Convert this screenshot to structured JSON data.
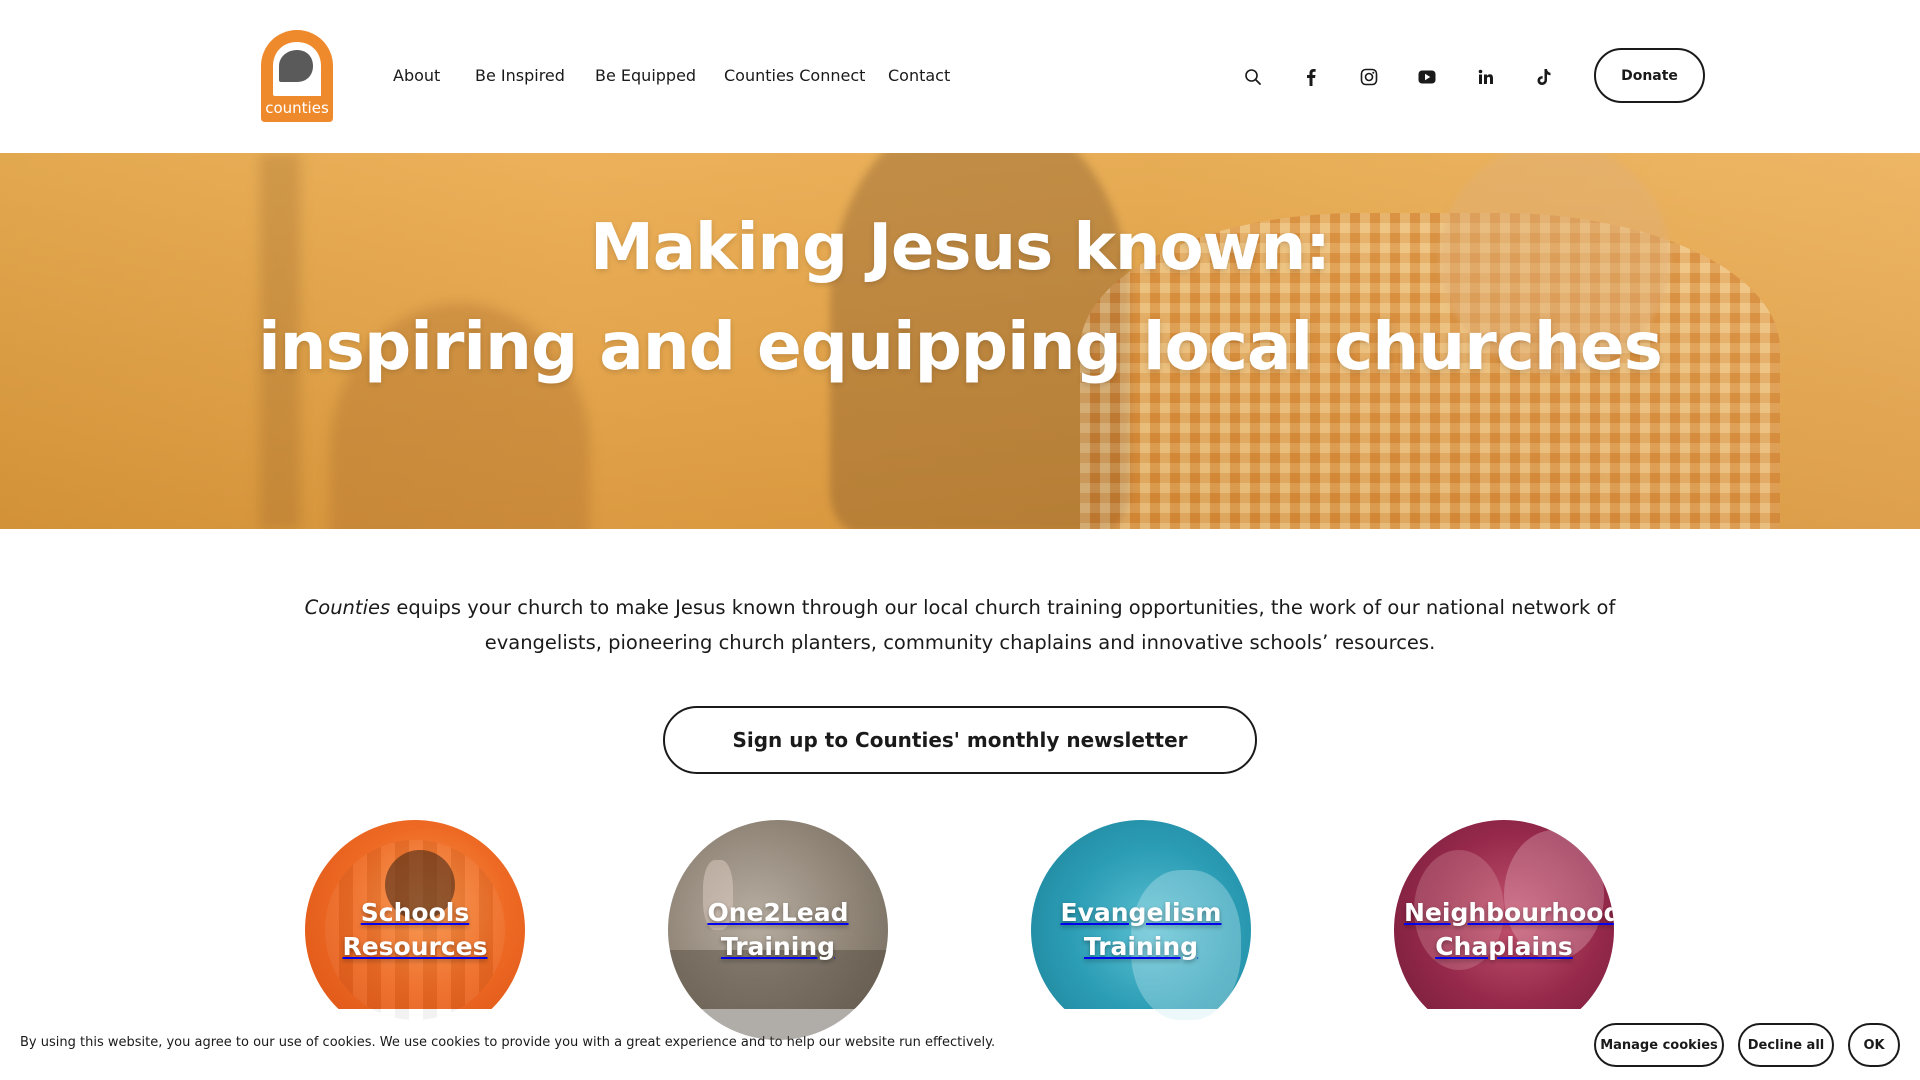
{
  "header": {
    "logo_text": "counties",
    "nav": [
      "About",
      "Be Inspired",
      "Be Equipped",
      "Counties Connect",
      "Contact"
    ],
    "icons": [
      "search-icon",
      "facebook-icon",
      "instagram-icon",
      "youtube-icon",
      "linkedin-icon",
      "tiktok-icon"
    ],
    "donate_label": "Donate"
  },
  "hero": {
    "line1": "Making Jesus known:",
    "line2": "inspiring and equipping local churches"
  },
  "intro": {
    "emphasis": "Counties",
    "text": " equips your church to make Jesus known through our local church training opportunities, the work of our national network of evangelists, pioneering church planters, community chaplains and innovative schools’ resources."
  },
  "newsletter_label": "Sign up to Counties' monthly newsletter",
  "circles": [
    {
      "line1": "Schools",
      "line2": "Resources"
    },
    {
      "line1": "One2Lead",
      "line2": "Training"
    },
    {
      "line1": "Evangelism",
      "line2": "Training"
    },
    {
      "line1": "Neighbourhood",
      "line2": "Chaplains"
    }
  ],
  "cookie": {
    "text": "By using this website, you agree to our use of cookies. We use cookies to provide you with a great experience and to help our website run effectively.",
    "manage_label": "Manage cookies",
    "decline_label": "Decline all",
    "ok_label": "OK"
  },
  "colors": {
    "brand_orange": "#ee8a2b",
    "hero_tint": "#e2a148",
    "text": "#1a1a1a"
  }
}
